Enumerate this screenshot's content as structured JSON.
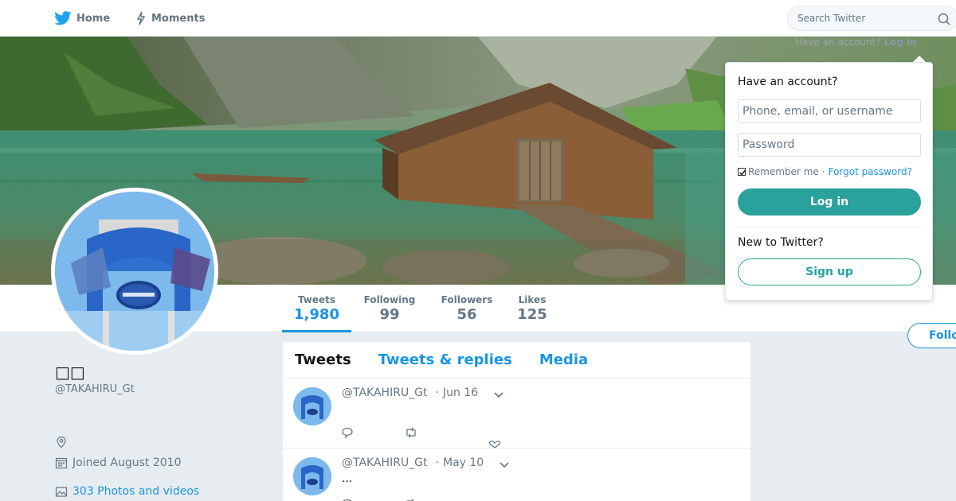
{
  "nav": {
    "home_label": "Home",
    "moments_label": "Moments",
    "search_placeholder": "Search Twitter"
  },
  "top_login_hint": {
    "text": "Have an account?",
    "link": "Log in"
  },
  "profile": {
    "name": "□□",
    "handle": "@TAKAHIRU_Gt",
    "joined": "Joined August 2010",
    "photos_link": "303 Photos and videos",
    "follow_button": "Follo"
  },
  "stats": [
    {
      "label": "Tweets",
      "value": "1,980"
    },
    {
      "label": "Following",
      "value": "99"
    },
    {
      "label": "Followers",
      "value": "56"
    },
    {
      "label": "Likes",
      "value": "125"
    }
  ],
  "timeline": {
    "tabs": [
      "Tweets",
      "Tweets & replies",
      "Media"
    ],
    "tweets": [
      {
        "handle": "@TAKAHIRU_Gt",
        "date": "Jun 16",
        "text": ""
      },
      {
        "handle": "@TAKAHIRU_Gt",
        "date": "May 10",
        "text": "..."
      }
    ]
  },
  "login_panel": {
    "title": "Have an account?",
    "username_placeholder": "Phone, email, or username",
    "password_placeholder": "Password",
    "remember_label": "Remember me",
    "separator": "·",
    "forgot_link": "Forgot password?",
    "login_button": "Log in",
    "new_label": "New to Twitter?",
    "signup_button": "Sign up"
  },
  "colors": {
    "accent": "#1b95e0",
    "login_accent": "#29a19c",
    "background": "#e6ecf0"
  },
  "icons": [
    "twitter-bird-icon",
    "lightning-icon",
    "search-icon",
    "location-icon",
    "calendar-icon",
    "photo-icon",
    "reply-icon",
    "retweet-icon",
    "like-icon",
    "chevron-down-icon"
  ]
}
